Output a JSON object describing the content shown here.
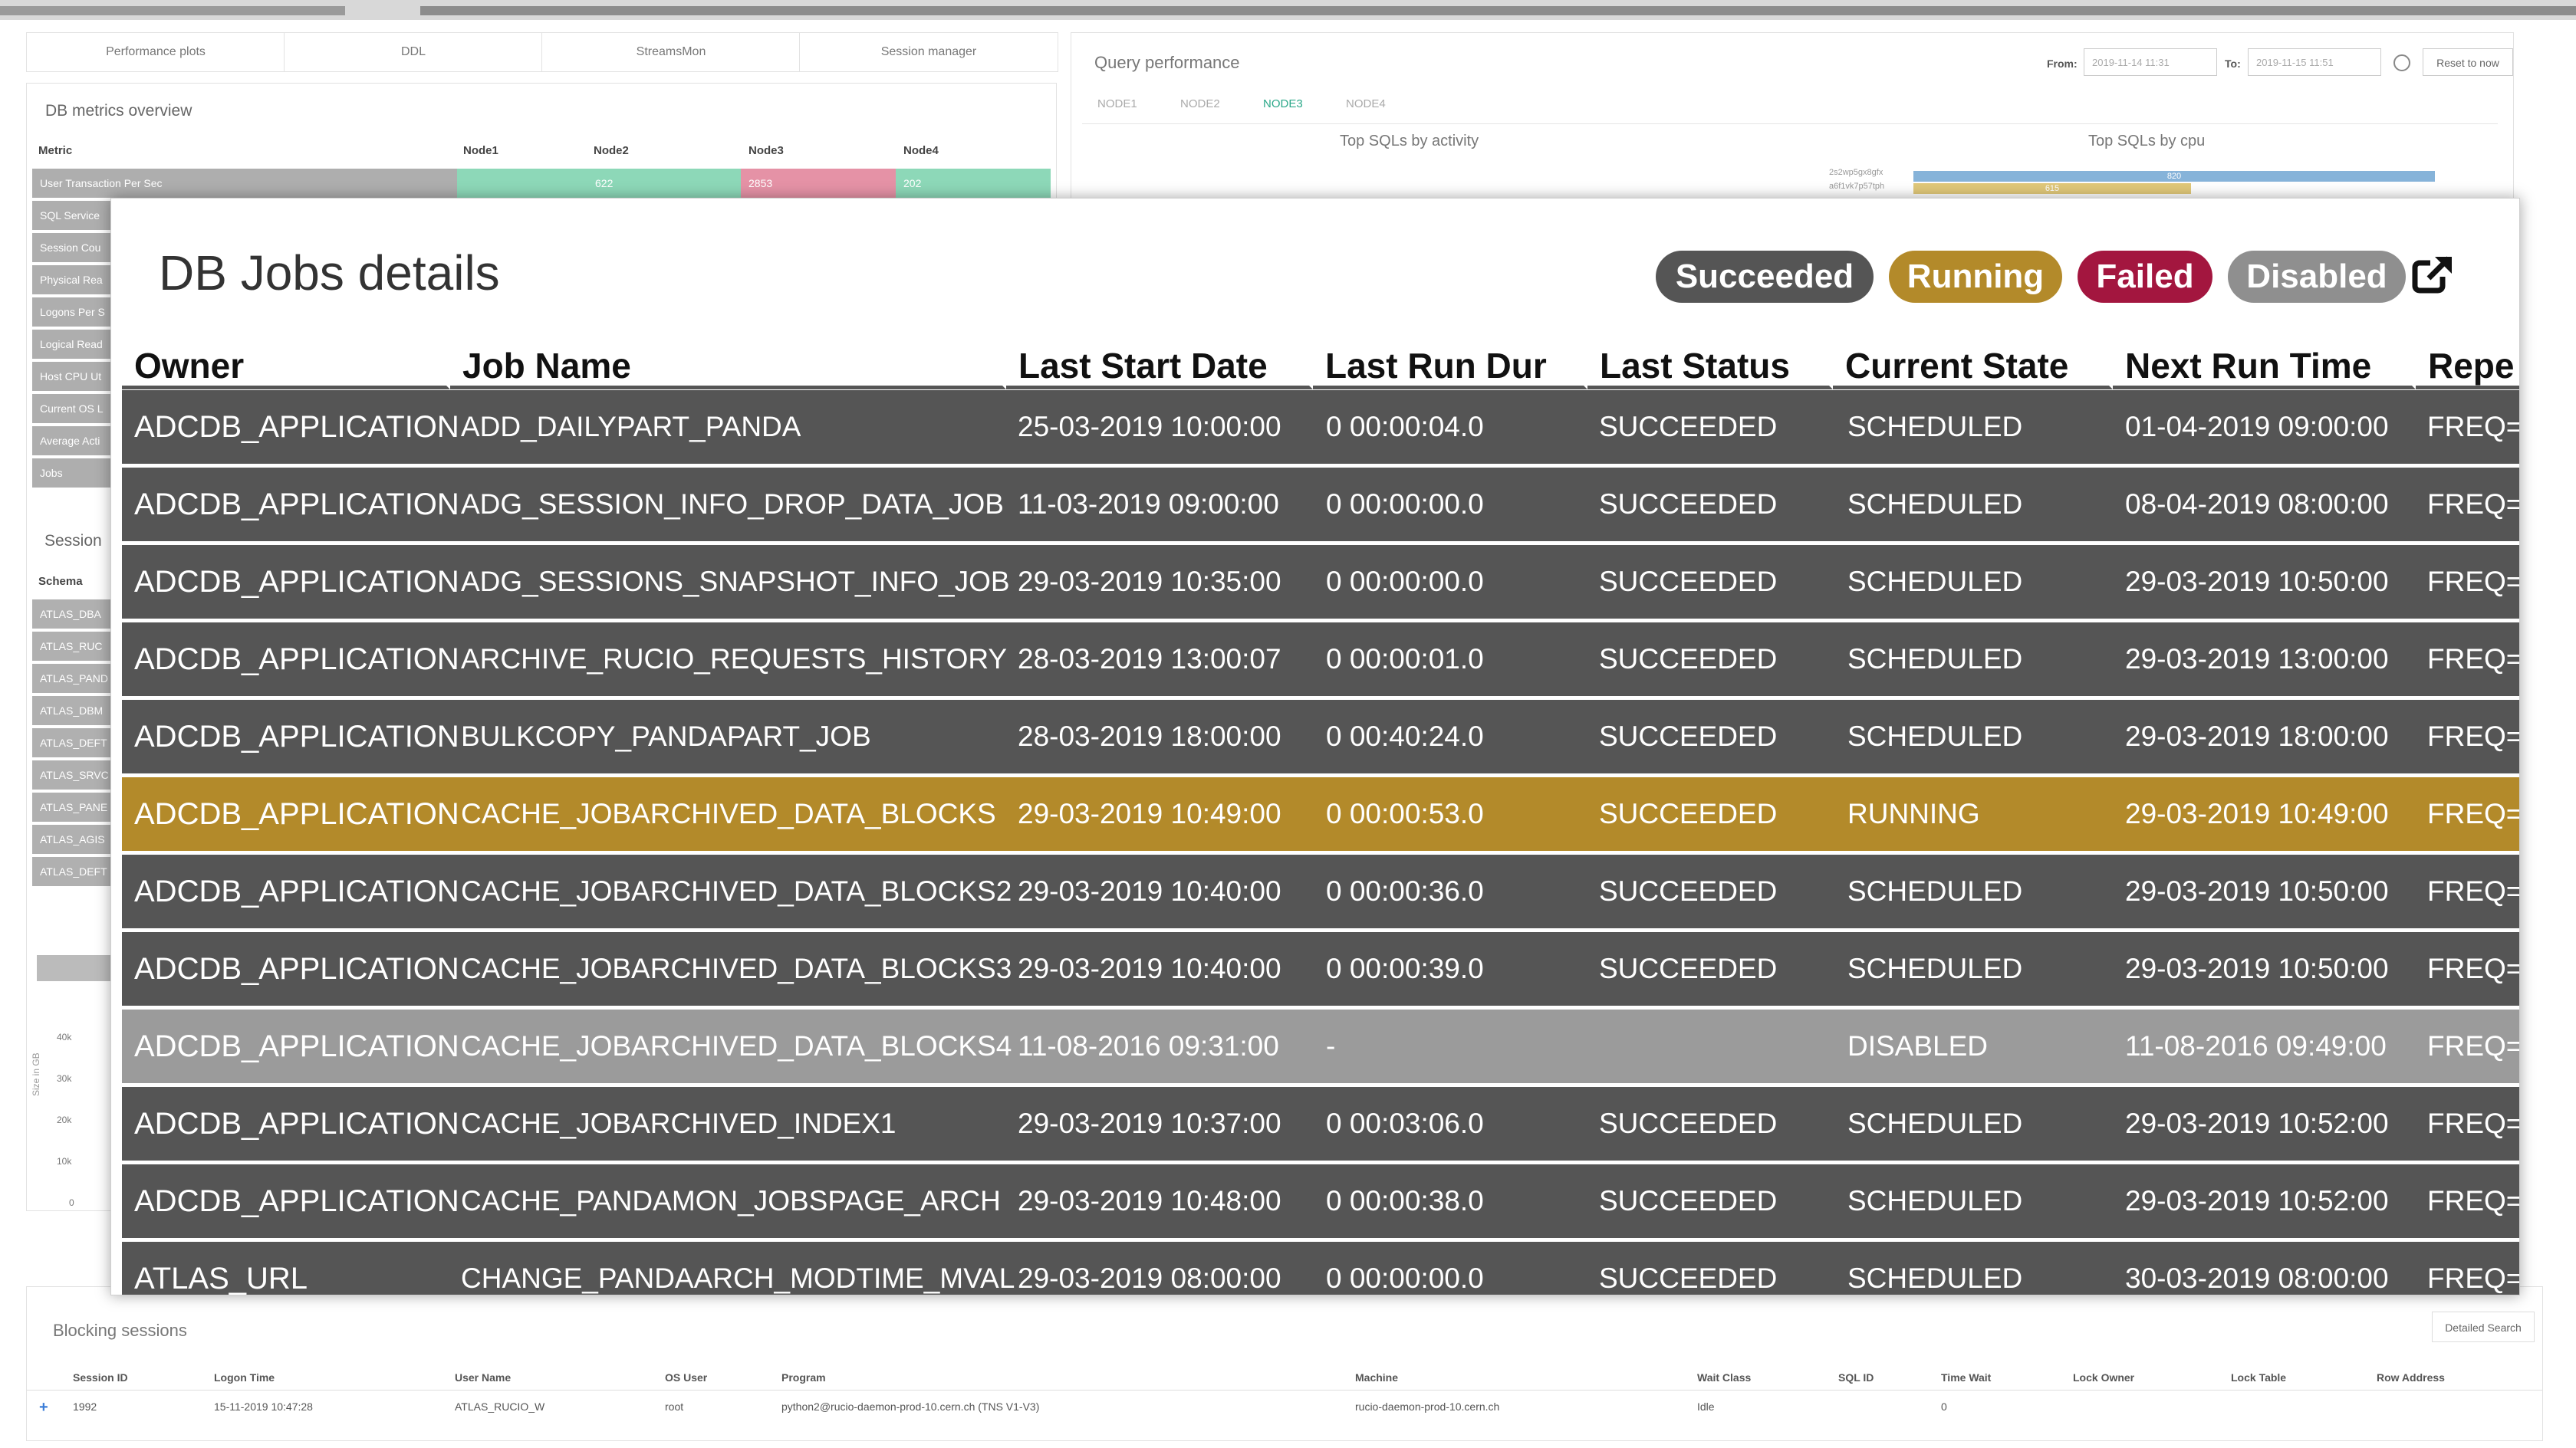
{
  "nav_tabs": [
    "Performance plots",
    "DDL",
    "StreamsMon",
    "Session manager"
  ],
  "db_metrics": {
    "title": "DB metrics overview",
    "headers": [
      "Metric",
      "Node1",
      "Node2",
      "Node3",
      "Node4"
    ],
    "first_row": {
      "metric": "User Transaction Per Sec",
      "node2": "622",
      "node3": "2853",
      "node4": "202"
    },
    "rows": [
      "SQL Service",
      "Session Cou",
      "Physical Rea",
      "Logons Per S",
      "Logical Read",
      "Host CPU Ut",
      "Current OS L",
      "Average Acti",
      "Jobs"
    ]
  },
  "sessions_panel": {
    "title": "Session",
    "header": "Schema",
    "rows": [
      "ATLAS_DBA",
      "ATLAS_RUC",
      "ATLAS_PAND",
      "ATLAS_DBM",
      "ATLAS_DEFT",
      "ATLAS_SRVC",
      "ATLAS_PANE",
      "ATLAS_AGIS",
      "ATLAS_DEFT"
    ]
  },
  "size_chart": {
    "ylabel": "Size in GB",
    "ticks": [
      "40k",
      "30k",
      "20k",
      "10k",
      "0"
    ]
  },
  "query_perf": {
    "title": "Query performance",
    "from_label": "From:",
    "from_value": "2019-11-14 11:31",
    "to_label": "To:",
    "to_value": "2019-11-15 11:51",
    "reset_label": "Reset to now",
    "nodes": [
      "NODE1",
      "NODE2",
      "NODE3",
      "NODE4"
    ],
    "active_node": "NODE3",
    "chart1_title": "Top SQLs by activity",
    "chart2_title": "Top SQLs by cpu",
    "cpu_labels": [
      "2s2wp5gx8gfx",
      "a6f1vk7p57tph"
    ],
    "cpu_values": [
      "820",
      "615"
    ]
  },
  "blocking": {
    "title": "Blocking sessions",
    "search_label": "Detailed Search",
    "headers": [
      "Session ID",
      "Logon Time",
      "User Name",
      "OS User",
      "Program",
      "Machine",
      "Wait Class",
      "SQL ID",
      "Time Wait",
      "Lock Owner",
      "Lock Table",
      "Row Address"
    ],
    "row": [
      "1992",
      "15-11-2019 10:47:28",
      "ATLAS_RUCIO_W",
      "root",
      "python2@rucio-daemon-prod-10.cern.ch (TNS V1-V3)",
      "rucio-daemon-prod-10.cern.ch",
      "Idle",
      "",
      "0",
      "",
      "",
      ""
    ]
  },
  "modal": {
    "title": "DB Jobs details",
    "badges": {
      "succeeded": "Succeeded",
      "running": "Running",
      "failed": "Failed",
      "disabled": "Disabled"
    },
    "colors": {
      "succeeded": "#555555",
      "running": "#b38a2a",
      "failed": "#a3163f",
      "disabled": "#8f8f8f",
      "row_normal": "#555555",
      "row_running": "#b38a2a",
      "row_disabled": "#9b9b9b"
    },
    "columns": [
      "Owner",
      "Job Name",
      "Last Start Date",
      "Last Run Dur",
      "Last Status",
      "Current State",
      "Next Run Time",
      "Repe"
    ],
    "rows": [
      {
        "owner": "ADCDB_APPLICATION",
        "job": "ADD_DAILYPART_PANDA",
        "start": "25-03-2019 10:00:00",
        "dur": "0 00:00:04.0",
        "status": "SUCCEEDED",
        "state": "SCHEDULED",
        "next": "01-04-2019 09:00:00",
        "repeat": "FREQ=",
        "kind": "normal"
      },
      {
        "owner": "ADCDB_APPLICATION",
        "job": "ADG_SESSION_INFO_DROP_DATA_JOB",
        "start": "11-03-2019 09:00:00",
        "dur": "0 00:00:00.0",
        "status": "SUCCEEDED",
        "state": "SCHEDULED",
        "next": "08-04-2019 08:00:00",
        "repeat": "FREQ=",
        "kind": "normal"
      },
      {
        "owner": "ADCDB_APPLICATION",
        "job": "ADG_SESSIONS_SNAPSHOT_INFO_JOB",
        "start": "29-03-2019 10:35:00",
        "dur": "0 00:00:00.0",
        "status": "SUCCEEDED",
        "state": "SCHEDULED",
        "next": "29-03-2019 10:50:00",
        "repeat": "FREQ=",
        "kind": "normal"
      },
      {
        "owner": "ADCDB_APPLICATION",
        "job": "ARCHIVE_RUCIO_REQUESTS_HISTORY",
        "start": "28-03-2019 13:00:07",
        "dur": "0 00:00:01.0",
        "status": "SUCCEEDED",
        "state": "SCHEDULED",
        "next": "29-03-2019 13:00:00",
        "repeat": "FREQ=",
        "kind": "normal"
      },
      {
        "owner": "ADCDB_APPLICATION",
        "job": "BULKCOPY_PANDAPART_JOB",
        "start": "28-03-2019 18:00:00",
        "dur": "0 00:40:24.0",
        "status": "SUCCEEDED",
        "state": "SCHEDULED",
        "next": "29-03-2019 18:00:00",
        "repeat": "FREQ=",
        "kind": "normal"
      },
      {
        "owner": "ADCDB_APPLICATION",
        "job": "CACHE_JOBARCHIVED_DATA_BLOCKS",
        "start": "29-03-2019 10:49:00",
        "dur": "0 00:00:53.0",
        "status": "SUCCEEDED",
        "state": "RUNNING",
        "next": "29-03-2019 10:49:00",
        "repeat": "FREQ=",
        "kind": "running"
      },
      {
        "owner": "ADCDB_APPLICATION",
        "job": "CACHE_JOBARCHIVED_DATA_BLOCKS2",
        "start": "29-03-2019 10:40:00",
        "dur": "0 00:00:36.0",
        "status": "SUCCEEDED",
        "state": "SCHEDULED",
        "next": "29-03-2019 10:50:00",
        "repeat": "FREQ=",
        "kind": "normal"
      },
      {
        "owner": "ADCDB_APPLICATION",
        "job": "CACHE_JOBARCHIVED_DATA_BLOCKS3",
        "start": "29-03-2019 10:40:00",
        "dur": "0 00:00:39.0",
        "status": "SUCCEEDED",
        "state": "SCHEDULED",
        "next": "29-03-2019 10:50:00",
        "repeat": "FREQ=",
        "kind": "normal"
      },
      {
        "owner": "ADCDB_APPLICATION",
        "job": "CACHE_JOBARCHIVED_DATA_BLOCKS4",
        "start": "11-08-2016 09:31:00",
        "dur": "-",
        "status": "",
        "state": "DISABLED",
        "next": "11-08-2016 09:49:00",
        "repeat": "FREQ=",
        "kind": "disabled"
      },
      {
        "owner": "ADCDB_APPLICATION",
        "job": "CACHE_JOBARCHIVED_INDEX1",
        "start": "29-03-2019 10:37:00",
        "dur": "0 00:03:06.0",
        "status": "SUCCEEDED",
        "state": "SCHEDULED",
        "next": "29-03-2019 10:52:00",
        "repeat": "FREQ=",
        "kind": "normal"
      },
      {
        "owner": "ADCDB_APPLICATION",
        "job": "CACHE_PANDAMON_JOBSPAGE_ARCH",
        "start": "29-03-2019 10:48:00",
        "dur": "0 00:00:38.0",
        "status": "SUCCEEDED",
        "state": "SCHEDULED",
        "next": "29-03-2019 10:52:00",
        "repeat": "FREQ=",
        "kind": "normal"
      },
      {
        "owner": "ATLAS_URL",
        "job": "CHANGE_PANDAARCH_MODTIME_MVAL",
        "start": "29-03-2019 08:00:00",
        "dur": "0 00:00:00.0",
        "status": "SUCCEEDED",
        "state": "SCHEDULED",
        "next": "30-03-2019 08:00:00",
        "repeat": "FREQ=",
        "kind": "normal"
      }
    ]
  }
}
